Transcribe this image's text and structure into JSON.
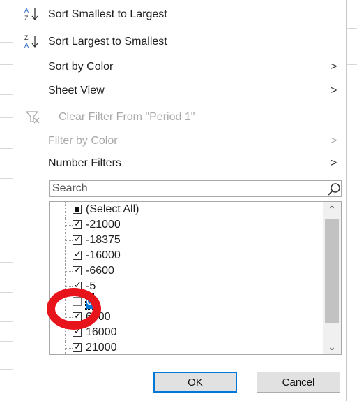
{
  "menu": {
    "sort_asc": "Sort Smallest to Largest",
    "sort_desc": "Sort Largest to Smallest",
    "sort_by_color": "Sort by Color",
    "sheet_view": "Sheet View",
    "clear_filter": "Clear Filter From \"Period 1\"",
    "filter_by_color": "Filter by Color",
    "number_filters": "Number Filters",
    "submenu_arrow": ">"
  },
  "search": {
    "placeholder": "Search"
  },
  "filter_list": {
    "items": [
      {
        "label": "(Select All)",
        "state": "partial"
      },
      {
        "label": "-21000",
        "state": "checked"
      },
      {
        "label": "-18375",
        "state": "checked"
      },
      {
        "label": "-16000",
        "state": "checked"
      },
      {
        "label": "-6600",
        "state": "checked"
      },
      {
        "label": "-5",
        "state": "checked"
      },
      {
        "label": "0",
        "state": "unchecked",
        "selected": true
      },
      {
        "label": "6000",
        "state": "checked"
      },
      {
        "label": "16000",
        "state": "checked"
      },
      {
        "label": "21000",
        "state": "checked"
      }
    ],
    "scroll_up": "^",
    "scroll_down": "v"
  },
  "buttons": {
    "ok": "OK",
    "cancel": "Cancel"
  },
  "icons": {
    "sort_asc": "sort-ascending-icon",
    "sort_desc": "sort-descending-icon",
    "clear_filter": "clear-filter-icon",
    "search": "search-icon"
  },
  "colors": {
    "accent": "#0078d7",
    "annotation": "#e8141b",
    "disabled": "#a9a9a9"
  }
}
